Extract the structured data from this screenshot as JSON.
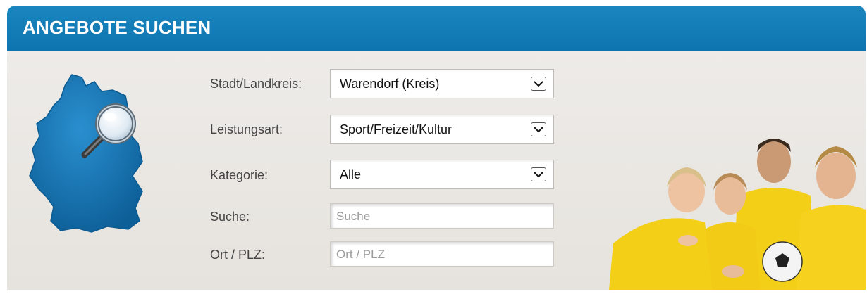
{
  "header": {
    "title": "ANGEBOTE SUCHEN"
  },
  "colors": {
    "header_blue": "#0e74af",
    "map_blue": "#1677b4",
    "shirt_yellow": "#f4cf18"
  },
  "map": {
    "icon": "germany-map-icon",
    "overlay_icon": "magnifier-icon"
  },
  "form": {
    "city": {
      "label": "Stadt/Landkreis:",
      "value": "Warendorf (Kreis)"
    },
    "service": {
      "label": "Leistungsart:",
      "value": "Sport/Freizeit/Kultur"
    },
    "category": {
      "label": "Kategorie:",
      "value": "Alle"
    },
    "search": {
      "label": "Suche:",
      "placeholder": "Suche"
    },
    "location": {
      "label": "Ort / PLZ:",
      "placeholder": "Ort / PLZ"
    }
  },
  "photo": {
    "subject": "children-in-yellow-sports-shirts-photo"
  }
}
